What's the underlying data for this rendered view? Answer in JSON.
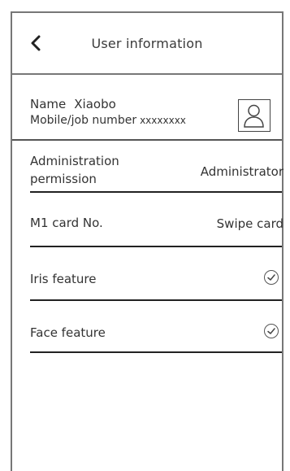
{
  "header": {
    "title": "User information",
    "back_icon": "chevron-left-icon"
  },
  "user": {
    "name_label": "Name",
    "name_value": "Xiaobo",
    "mobile_label": "Mobile/job number",
    "mobile_value": "xxxxxxxx",
    "avatar_icon": "user-avatar-icon"
  },
  "fields": {
    "admin": {
      "label_line1": "Administration",
      "label_line2": "permission",
      "value": "Administrator"
    },
    "m1": {
      "label": "M1 card No.",
      "value": "Swipe card"
    },
    "iris": {
      "label": "Iris feature",
      "status_icon": "check-circle-icon"
    },
    "face": {
      "label": "Face feature",
      "status_icon": "check-circle-icon"
    }
  }
}
